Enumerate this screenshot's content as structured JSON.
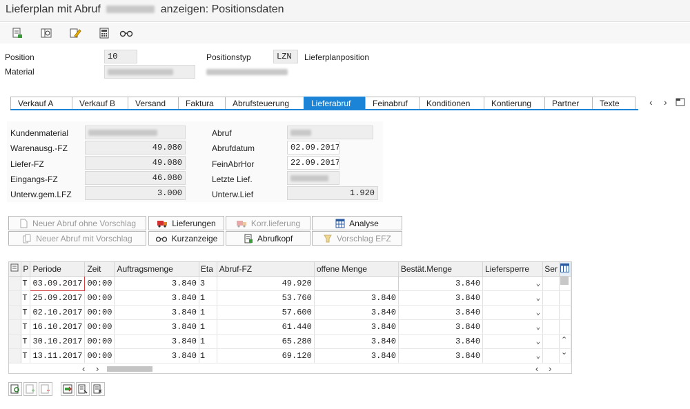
{
  "window": {
    "title_prefix": "Lieferplan mit Abruf",
    "title_suffix": "anzeigen: Positionsdaten"
  },
  "toolbar": {
    "icons": [
      "header-data-icon",
      "overview-icon",
      "edit-icon",
      "calculator-icon",
      "display-icon"
    ]
  },
  "header": {
    "position_label": "Position",
    "position_value": "10",
    "material_label": "Material",
    "positionstyp_label": "Positionstyp",
    "positionstyp_value": "LZN",
    "positionstyp_text": "Lieferplanposition"
  },
  "tabs": [
    "Verkauf A",
    "Verkauf B",
    "Versand",
    "Faktura",
    "Abrufsteuerung",
    "Lieferabruf",
    "Feinabruf",
    "Konditionen",
    "Kontierung",
    "Partner",
    "Texte"
  ],
  "active_tab": "Lieferabruf",
  "detail": {
    "kundenmaterial_label": "Kundenmaterial",
    "warenausg_label": "Warenausg.-FZ",
    "warenausg_value": "49.080",
    "liefer_label": "Liefer-FZ",
    "liefer_value": "49.080",
    "eingangs_label": "Eingangs-FZ",
    "eingangs_value": "46.080",
    "unterw_label": "Unterw.gem.LFZ",
    "unterw_value": "3.000",
    "abruf_label": "Abruf",
    "abrufdatum_label": "Abrufdatum",
    "abrufdatum_value": "02.09.2017",
    "feinabrhor_label": "FeinAbrHor",
    "feinabrhor_value": "22.09.2017",
    "letzte_label": "Letzte Lief.",
    "unterwlief_label": "Unterw.Lief",
    "unterwlief_value": "1.920"
  },
  "actions": {
    "neuer_ohne": "Neuer Abruf ohne Vorschlag",
    "neuer_mit": "Neuer Abruf mit Vorschlag",
    "lieferungen": "Lieferungen",
    "kurzanzeige": "Kurzanzeige",
    "korr": "Korr.lieferung",
    "abrufkopf": "Abrufkopf",
    "analyse": "Analyse",
    "vorschlag": "Vorschlag EFZ"
  },
  "grid": {
    "columns": [
      "P",
      "Periode",
      "Zeit",
      "Auftragsmenge",
      "Eta",
      "Abruf-FZ",
      "offene Menge",
      "Bestät.Menge",
      "Liefersperre",
      "Ser"
    ],
    "rows": [
      {
        "p": "T",
        "periode": "03.09.2017",
        "zeit": "00:00",
        "auftragsmenge": "3.840",
        "eta": "3",
        "abruf_fz": "49.920",
        "offene": "",
        "bestaet": "3.840"
      },
      {
        "p": "T",
        "periode": "25.09.2017",
        "zeit": "00:00",
        "auftragsmenge": "3.840",
        "eta": "1",
        "abruf_fz": "53.760",
        "offene": "3.840",
        "bestaet": "3.840"
      },
      {
        "p": "T",
        "periode": "02.10.2017",
        "zeit": "00:00",
        "auftragsmenge": "3.840",
        "eta": "1",
        "abruf_fz": "57.600",
        "offene": "3.840",
        "bestaet": "3.840"
      },
      {
        "p": "T",
        "periode": "16.10.2017",
        "zeit": "00:00",
        "auftragsmenge": "3.840",
        "eta": "1",
        "abruf_fz": "61.440",
        "offene": "3.840",
        "bestaet": "3.840"
      },
      {
        "p": "T",
        "periode": "30.10.2017",
        "zeit": "00:00",
        "auftragsmenge": "3.840",
        "eta": "1",
        "abruf_fz": "65.280",
        "offene": "3.840",
        "bestaet": "3.840"
      },
      {
        "p": "T",
        "periode": "13.11.2017",
        "zeit": "00:00",
        "auftragsmenge": "3.840",
        "eta": "1",
        "abruf_fz": "69.120",
        "offene": "3.840",
        "bestaet": "3.840"
      }
    ]
  },
  "colors": {
    "accent": "#1b84d6"
  }
}
